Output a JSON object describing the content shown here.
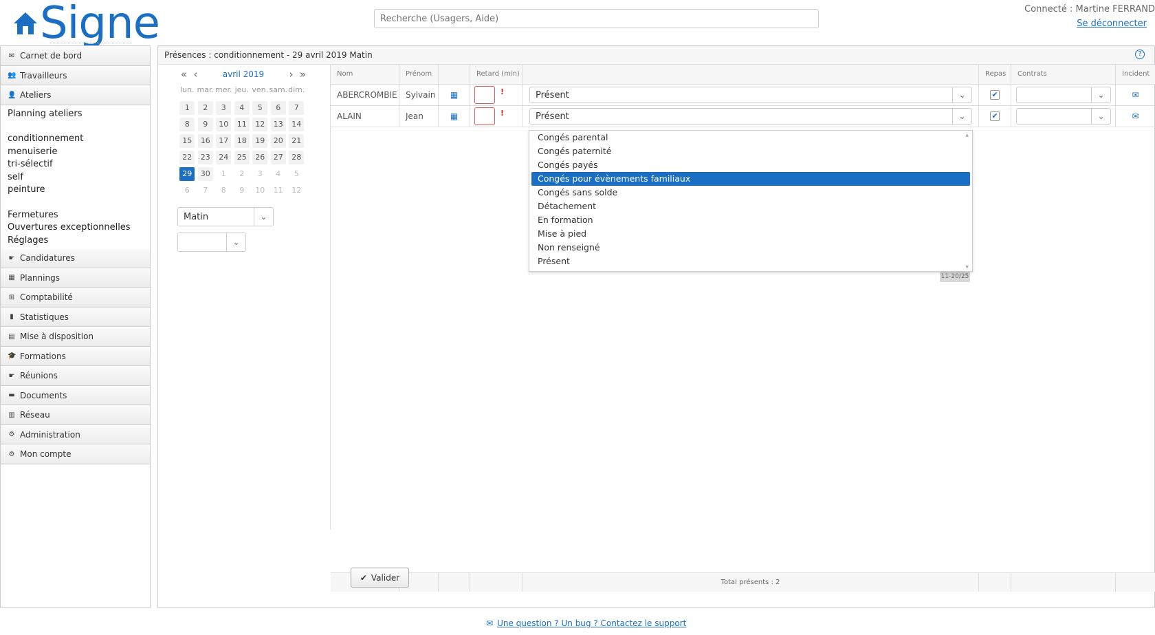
{
  "brand": {
    "name": "Signe"
  },
  "search": {
    "placeholder": "Recherche (Usagers, Aide)"
  },
  "user": {
    "connected": "Connecté : Martine FERRAND",
    "logout": "Se déconnecter"
  },
  "sidebar": {
    "items": [
      {
        "icon": "envelope-icon",
        "label": "Carnet de bord"
      },
      {
        "icon": "users-icon",
        "label": "Travailleurs"
      },
      {
        "icon": "user-tie-icon",
        "label": "Ateliers"
      }
    ],
    "ateliers_sub": {
      "planning": "Planning ateliers",
      "workshops": [
        "conditionnement",
        "menuiserie",
        "tri-sélectif",
        "self",
        "peinture"
      ],
      "others": [
        "Fermetures",
        "Ouvertures exceptionnelles",
        "Réglages"
      ]
    },
    "items_after": [
      {
        "icon": "handshake-icon",
        "label": "Candidatures"
      },
      {
        "icon": "calendar-icon",
        "label": "Plannings"
      },
      {
        "icon": "coins-icon",
        "label": "Comptabilité"
      },
      {
        "icon": "bar-chart-icon",
        "label": "Statistiques"
      },
      {
        "icon": "building-icon",
        "label": "Mise à disposition"
      },
      {
        "icon": "graduation-cap-icon",
        "label": "Formations"
      },
      {
        "icon": "handshake-icon",
        "label": "Réunions"
      },
      {
        "icon": "folder-icon",
        "label": "Documents"
      },
      {
        "icon": "network-icon",
        "label": "Réseau"
      },
      {
        "icon": "gears-icon",
        "label": "Administration"
      },
      {
        "icon": "gear-icon",
        "label": "Mon compte"
      }
    ]
  },
  "panel": {
    "title": "Présences : conditionnement - 29 avril 2019 Matin"
  },
  "calendar": {
    "month": "avril 2019",
    "weekdays": [
      "lun.",
      "mar.",
      "mer.",
      "jeu.",
      "ven.",
      "sam.",
      "dim."
    ],
    "weeks": [
      [
        "1",
        "2",
        "3",
        "4",
        "5",
        "6",
        "7"
      ],
      [
        "8",
        "9",
        "10",
        "11",
        "12",
        "13",
        "14"
      ],
      [
        "15",
        "16",
        "17",
        "18",
        "19",
        "20",
        "21"
      ],
      [
        "22",
        "23",
        "24",
        "25",
        "26",
        "27",
        "28"
      ],
      [
        "29",
        "30",
        "1",
        "2",
        "3",
        "4",
        "5"
      ],
      [
        "6",
        "7",
        "8",
        "9",
        "10",
        "11",
        "12"
      ]
    ],
    "selected": "29"
  },
  "period_select": {
    "value": "Matin"
  },
  "second_select": {
    "value": ""
  },
  "table": {
    "headers": {
      "nom": "Nom",
      "prenom": "Prénom",
      "retard": "Retard (min)",
      "repas": "Repas",
      "contrats": "Contrats",
      "incident": "Incident"
    },
    "rows": [
      {
        "nom": "ABERCROMBIE",
        "prenom": "Sylvain",
        "retard_flag": "!",
        "status": "Présent",
        "repas": true
      },
      {
        "nom": "ALAIN",
        "prenom": "Jean",
        "retard_flag": "!",
        "status": "Présent",
        "repas": true
      }
    ],
    "footer": "Total présents : 2",
    "version": "11-20/25"
  },
  "status_dropdown": {
    "options": [
      "Congés parental",
      "Congés paternité",
      "Congés payés",
      "Congés pour évènements familiaux",
      "Congés sans solde",
      "Détachement",
      "En formation",
      "Mise à pied",
      "Non renseigné",
      "Présent"
    ],
    "highlighted": "Congés pour évènements familiaux"
  },
  "validate_button": {
    "label": "Valider"
  },
  "support": {
    "text": "Une question ? Un bug ? Contactez le support"
  },
  "colors": {
    "accent": "#1a6fc4",
    "error": "#e02020"
  }
}
